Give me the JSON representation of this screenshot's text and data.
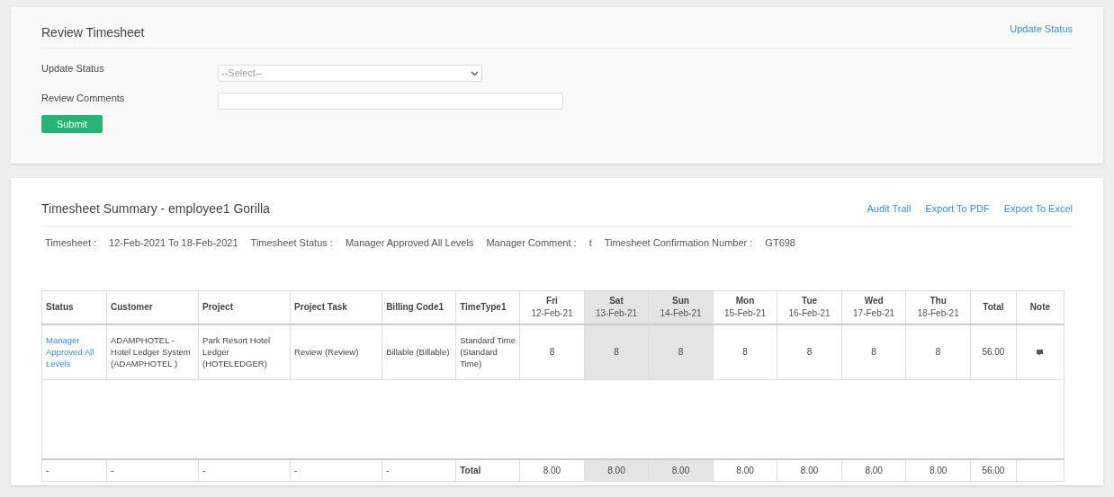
{
  "review": {
    "title": "Review Timesheet",
    "link": "Update Status",
    "status_label": "Update Status",
    "status_placeholder": "--Select--",
    "comments_label": "Review Comments",
    "submit": "Submit"
  },
  "summary": {
    "title": "Timesheet Summary - employee1 Gorilla",
    "links": [
      "Audit Trail",
      "Export To PDF",
      "Export To Excel"
    ],
    "info": [
      {
        "label": "Timesheet :",
        "value": "12-Feb-2021 To 18-Feb-2021"
      },
      {
        "label": "Timesheet Status :",
        "value": "Manager Approved All Levels"
      },
      {
        "label": "Manager Comment :",
        "value": "t"
      },
      {
        "label": "Timesheet Confirmation Number :",
        "value": "GT698"
      }
    ]
  },
  "table": {
    "columns": [
      "Status",
      "Customer",
      "Project",
      "Project Task",
      "Billing Code1",
      "TimeType1"
    ],
    "days": [
      {
        "day": "Fri",
        "date": "12-Feb-21",
        "weekend": false
      },
      {
        "day": "Sat",
        "date": "13-Feb-21",
        "weekend": true
      },
      {
        "day": "Sun",
        "date": "14-Feb-21",
        "weekend": true
      },
      {
        "day": "Mon",
        "date": "15-Feb-21",
        "weekend": false
      },
      {
        "day": "Tue",
        "date": "16-Feb-21",
        "weekend": false
      },
      {
        "day": "Wed",
        "date": "17-Feb-21",
        "weekend": false
      },
      {
        "day": "Thu",
        "date": "18-Feb-21",
        "weekend": false
      }
    ],
    "total_column": "Total",
    "note_column": "Note",
    "rows": [
      {
        "cells": [
          "Manager Approved All Levels",
          "ADAMPHOTEL - Hotel Ledger System (ADAMPHOTEL )",
          "Park Resort Hotel Ledger (HOTELEDGER)",
          "Review (Review)",
          "Billable (Billable)",
          "Standard Time (Standard Time)"
        ],
        "hours": [
          "8",
          "8",
          "8",
          "8",
          "8",
          "8",
          "8"
        ],
        "total": "56.00",
        "has_note": true
      }
    ],
    "footer": {
      "cells": [
        "-",
        "-",
        "-",
        "-",
        "-",
        "Total"
      ],
      "hours": [
        "8.00",
        "8.00",
        "8.00",
        "8.00",
        "8.00",
        "8.00",
        "8.00"
      ],
      "total": "56.00"
    }
  }
}
